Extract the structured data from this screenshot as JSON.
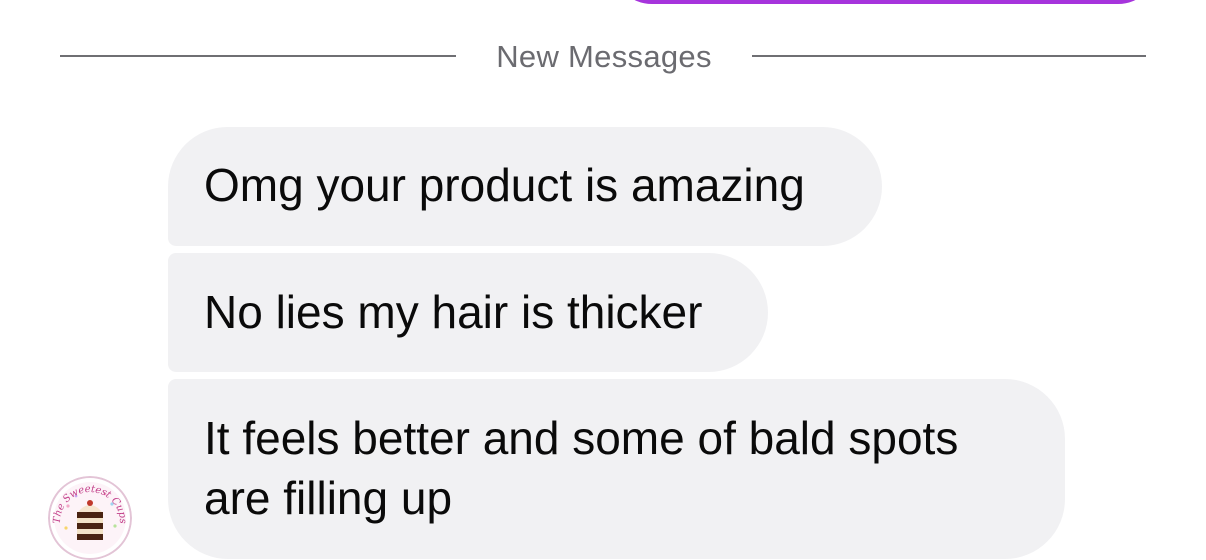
{
  "divider": {
    "label": "New Messages"
  },
  "messages": [
    {
      "text": "Omg your product is amazing"
    },
    {
      "text": "No lies my hair is thicker"
    },
    {
      "text": "It feels better and some of bald spots are filling up"
    }
  ],
  "avatar": {
    "logo_text": "The Sweetest Cups"
  },
  "colors": {
    "sent_bubble": "#a634dc",
    "received_bubble": "#f1f1f3",
    "divider": "#6f6f73"
  }
}
